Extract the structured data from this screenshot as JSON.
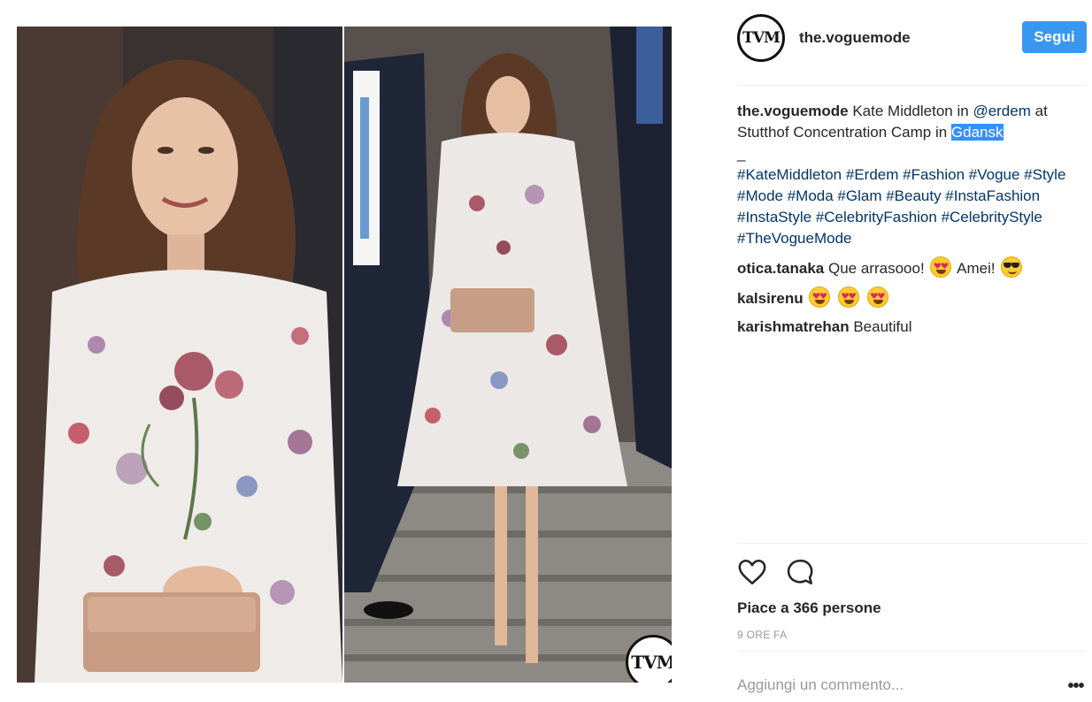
{
  "post": {
    "author": "the.voguemode",
    "avatar_text": "TVM",
    "follow_label": "Segui",
    "watermark_text": "TVM"
  },
  "caption": {
    "username": "the.voguemode",
    "text_1": " Kate Middleton in ",
    "mention": "@erdem",
    "text_2": " at Stutthof Concentration Camp in ",
    "location_highlighted": "Gdansk",
    "separator": "_",
    "hashtags": "#KateMiddleton #Erdem #Fashion #Vogue #Style #Mode #Moda #Glam #Beauty #InstaFashion #InstaStyle #CelebrityFashion #CelebrityStyle #TheVogueMode"
  },
  "comments": [
    {
      "username": "otica.tanaka",
      "text": " Que arrasooo! ",
      "text_after": " Amei! ",
      "emojis": [
        "heart-eyes-emoji",
        "sunglasses-emoji"
      ]
    },
    {
      "username": "kalsirenu",
      "emojis": [
        "heart-eyes-emoji",
        "heart-eyes-emoji",
        "heart-eyes-emoji"
      ]
    },
    {
      "username": "karishmatrehan",
      "text": " Beautiful"
    }
  ],
  "stats": {
    "likes_text": "Piace a 366 persone",
    "time_ago": "9 ORE FA"
  },
  "composer": {
    "placeholder": "Aggiungi un commento...",
    "more_label": "•••"
  },
  "icons": {
    "like": "heart-icon",
    "comment": "comment-bubble-icon",
    "more": "more-options-icon"
  },
  "colors": {
    "follow_button": "#3897f0",
    "link": "#003569",
    "highlight": "#3390ff"
  }
}
